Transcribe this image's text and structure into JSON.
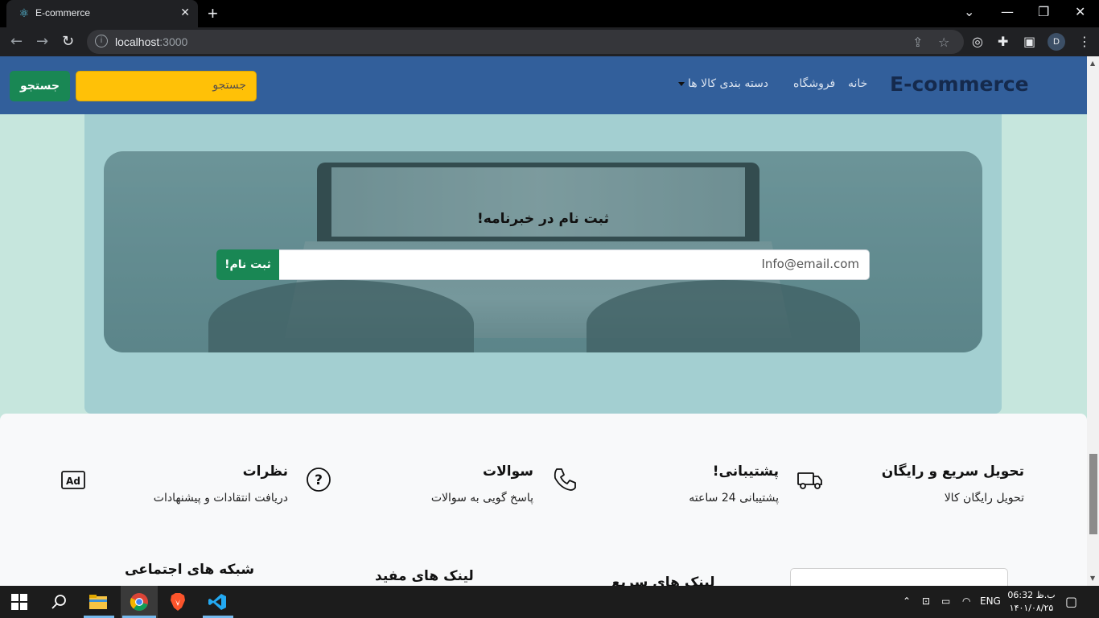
{
  "browser": {
    "tab_title": "E-commerce",
    "new_tab_label": "+",
    "url_host": "localhost",
    "url_port": ":3000",
    "profile_initial": "D"
  },
  "navbar": {
    "brand": "E-commerce",
    "links": [
      "خانه",
      "فروشگاه",
      "دسته بندی کالا ها"
    ],
    "search_placeholder": "جستجو",
    "search_button": "جستجو"
  },
  "newsletter": {
    "title": "ثبت نام در خبرنامه!",
    "email_placeholder": "Info@email.com",
    "signup_button": "ثبت نام!"
  },
  "features": [
    {
      "title": "تحویل سریع و رایگان",
      "desc": "تحویل رایگان کالا",
      "icon": "truck-icon"
    },
    {
      "title": "پشتیبانی!",
      "desc": "پشتیبانی 24 ساعته",
      "icon": "phone-icon"
    },
    {
      "title": "سوالات",
      "desc": "پاسخ گویی به سوالات",
      "icon": "question-icon"
    },
    {
      "title": "نظرات",
      "desc": "دریافت انتقادات و پیشنهادات",
      "icon": "ad-icon"
    }
  ],
  "footer": {
    "social_heading": "شبکه های اجتماعی",
    "useful_links_heading": "لینک های مفید",
    "quick_links_heading": "لینک های سریع"
  },
  "taskbar": {
    "lang": "ENG",
    "time": "06:32 ب.ظ",
    "date": "۱۴۰۱/۰۸/۲۵"
  },
  "colors": {
    "navbar_bg": "#325f9b",
    "search_bg": "#ffc107",
    "button_green": "#198754",
    "page_bg": "#c6e6dd",
    "panel_bg": "#a3cfd1"
  }
}
